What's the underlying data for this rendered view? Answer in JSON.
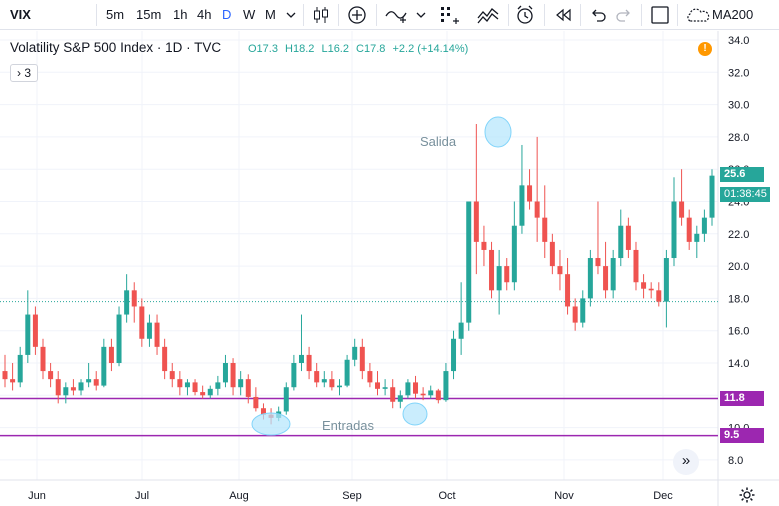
{
  "toolbar": {
    "symbol": "VIX",
    "intervals": [
      "5m",
      "15m",
      "1h",
      "4h",
      "D",
      "W",
      "M"
    ],
    "active_interval": "D",
    "indicator": "MA200",
    "icons": [
      "chevron-down-icon",
      "candles-icon",
      "add-compare-icon",
      "line-tool-icon",
      "indicators-icon",
      "templates-icon",
      "alert-icon",
      "replay-icon",
      "undo-icon",
      "redo-icon",
      "fullscreen-icon",
      "cloud-icon"
    ]
  },
  "legend": {
    "title": "Volatility S&P 500 Index · 1D · TVC",
    "open": "O17.3",
    "high": "H18.2",
    "low": "L16.2",
    "close": "C17.8",
    "change": "+2.2 (+14.14%)",
    "collapse_label": "› 3",
    "warning": "!"
  },
  "price_axis": {
    "ticks": [
      "34.0",
      "32.0",
      "30.0",
      "28.0",
      "26.0",
      "24.0",
      "22.0",
      "20.0",
      "18.0",
      "16.0",
      "14.0",
      "12.0",
      "10.0",
      "8.0"
    ]
  },
  "time_axis": {
    "ticks": [
      "Jun",
      "Jul",
      "Aug",
      "Sep",
      "Oct",
      "Nov",
      "Dec"
    ]
  },
  "price_labels": {
    "last": "25.6",
    "countdown": "01:38:45",
    "line_upper": "11.8",
    "line_lower": "9.5"
  },
  "annotations": {
    "exit_text": "Salida",
    "entry_text": "Entradas"
  },
  "colors": {
    "up": "#26a69a",
    "down": "#ef5350",
    "horizontal_line": "#9c27b0",
    "marker": "#b3e5fc",
    "accent": "#2962ff"
  },
  "chart_data": {
    "type": "candlestick",
    "ylim": [
      7,
      34.5
    ],
    "horizontal_lines": [
      11.8,
      9.5
    ],
    "prev_close_line": 17.8,
    "series": [
      {
        "name": "VIX",
        "candles": [
          [
            13.5,
            14.5,
            12.5,
            13.0
          ],
          [
            13.0,
            14.0,
            12.3,
            12.8
          ],
          [
            12.8,
            15.0,
            12.5,
            14.5
          ],
          [
            14.5,
            18.5,
            14.0,
            17.0
          ],
          [
            17.0,
            17.5,
            14.5,
            15.0
          ],
          [
            15.0,
            15.5,
            13.0,
            13.5
          ],
          [
            13.5,
            14.0,
            12.5,
            13.0
          ],
          [
            13.0,
            13.5,
            11.5,
            12.0
          ],
          [
            12.0,
            12.8,
            11.5,
            12.5
          ],
          [
            12.5,
            13.0,
            12.0,
            12.3
          ],
          [
            12.3,
            13.0,
            12.0,
            12.8
          ],
          [
            12.8,
            14.0,
            12.5,
            13.0
          ],
          [
            13.0,
            13.5,
            12.3,
            12.6
          ],
          [
            12.6,
            15.5,
            12.5,
            15.0
          ],
          [
            15.0,
            15.5,
            13.5,
            14.0
          ],
          [
            14.0,
            17.5,
            13.8,
            17.0
          ],
          [
            17.0,
            19.5,
            16.5,
            18.5
          ],
          [
            18.5,
            19.0,
            16.5,
            17.5
          ],
          [
            17.5,
            18.0,
            15.0,
            15.5
          ],
          [
            15.5,
            17.0,
            15.0,
            16.5
          ],
          [
            16.5,
            17.0,
            14.5,
            15.0
          ],
          [
            15.0,
            15.5,
            13.0,
            13.5
          ],
          [
            13.5,
            14.0,
            12.5,
            13.0
          ],
          [
            13.0,
            13.5,
            12.0,
            12.5
          ],
          [
            12.5,
            13.0,
            12.0,
            12.8
          ],
          [
            12.8,
            13.0,
            12.0,
            12.2
          ],
          [
            12.2,
            12.6,
            11.8,
            12.0
          ],
          [
            12.0,
            12.6,
            11.8,
            12.4
          ],
          [
            12.4,
            13.2,
            12.0,
            12.8
          ],
          [
            12.8,
            14.5,
            12.5,
            14.0
          ],
          [
            14.0,
            14.3,
            12.0,
            12.5
          ],
          [
            12.5,
            13.5,
            12.0,
            13.0
          ],
          [
            13.0,
            13.3,
            11.5,
            11.9
          ],
          [
            11.9,
            12.5,
            11.0,
            11.2
          ],
          [
            11.2,
            11.5,
            10.5,
            10.8
          ],
          [
            10.8,
            11.2,
            10.2,
            10.6
          ],
          [
            10.6,
            11.3,
            10.4,
            11.0
          ],
          [
            11.0,
            12.8,
            10.8,
            12.5
          ],
          [
            12.5,
            14.5,
            12.3,
            14.0
          ],
          [
            14.0,
            17.0,
            13.5,
            14.5
          ],
          [
            14.5,
            15.0,
            13.0,
            13.5
          ],
          [
            13.5,
            14.0,
            12.5,
            12.8
          ],
          [
            12.8,
            13.5,
            12.5,
            13.0
          ],
          [
            13.0,
            13.5,
            12.3,
            12.5
          ],
          [
            12.5,
            13.0,
            12.0,
            12.6
          ],
          [
            12.6,
            14.5,
            12.5,
            14.2
          ],
          [
            14.2,
            15.5,
            13.8,
            15.0
          ],
          [
            15.0,
            15.5,
            13.0,
            13.5
          ],
          [
            13.5,
            14.0,
            12.5,
            12.8
          ],
          [
            12.8,
            13.5,
            12.0,
            12.4
          ],
          [
            12.4,
            13.0,
            12.0,
            12.5
          ],
          [
            12.5,
            13.0,
            11.2,
            11.6
          ],
          [
            11.6,
            12.3,
            11.2,
            12.0
          ],
          [
            12.0,
            13.0,
            11.8,
            12.8
          ],
          [
            12.8,
            13.2,
            11.8,
            12.1
          ],
          [
            12.1,
            12.5,
            11.7,
            12.0
          ],
          [
            12.0,
            12.6,
            11.8,
            12.3
          ],
          [
            12.3,
            12.4,
            11.5,
            11.7
          ],
          [
            11.7,
            14.0,
            11.6,
            13.5
          ],
          [
            13.5,
            16.0,
            13.0,
            15.5
          ],
          [
            15.5,
            19.0,
            14.5,
            16.5
          ],
          [
            16.5,
            24.0,
            16.0,
            24.0
          ],
          [
            24.0,
            28.8,
            19.5,
            21.5
          ],
          [
            21.5,
            22.5,
            20.0,
            21.0
          ],
          [
            21.0,
            21.5,
            18.0,
            18.5
          ],
          [
            18.5,
            21.0,
            17.0,
            20.0
          ],
          [
            20.0,
            20.5,
            18.5,
            19.0
          ],
          [
            19.0,
            24.0,
            18.5,
            22.5
          ],
          [
            22.5,
            27.5,
            22.0,
            25.0
          ],
          [
            25.0,
            26.0,
            23.5,
            24.0
          ],
          [
            24.0,
            28.0,
            21.5,
            23.0
          ],
          [
            23.0,
            25.0,
            20.5,
            21.5
          ],
          [
            21.5,
            22.0,
            19.5,
            20.0
          ],
          [
            20.0,
            21.0,
            18.5,
            19.5
          ],
          [
            19.5,
            20.5,
            17.0,
            17.5
          ],
          [
            17.5,
            18.0,
            16.0,
            16.5
          ],
          [
            16.5,
            18.5,
            16.2,
            18.0
          ],
          [
            18.0,
            21.0,
            17.5,
            20.5
          ],
          [
            20.5,
            24.0,
            19.5,
            20.0
          ],
          [
            20.0,
            21.5,
            18.0,
            18.5
          ],
          [
            18.5,
            21.0,
            18.0,
            20.5
          ],
          [
            20.5,
            23.5,
            20.0,
            22.5
          ],
          [
            22.5,
            23.0,
            20.5,
            21.0
          ],
          [
            21.0,
            21.5,
            18.5,
            19.0
          ],
          [
            19.0,
            19.5,
            18.0,
            18.6
          ],
          [
            18.6,
            19.0,
            18.0,
            18.5
          ],
          [
            18.5,
            19.0,
            17.5,
            17.8
          ],
          [
            17.8,
            21.0,
            16.2,
            20.5
          ],
          [
            20.5,
            25.5,
            20.0,
            24.0
          ],
          [
            24.0,
            26.0,
            22.5,
            23.0
          ],
          [
            23.0,
            23.5,
            21.0,
            21.5
          ],
          [
            21.5,
            22.5,
            20.5,
            22.0
          ],
          [
            22.0,
            23.5,
            21.5,
            23.0
          ],
          [
            23.0,
            26.0,
            22.5,
            25.6
          ]
        ]
      }
    ]
  }
}
